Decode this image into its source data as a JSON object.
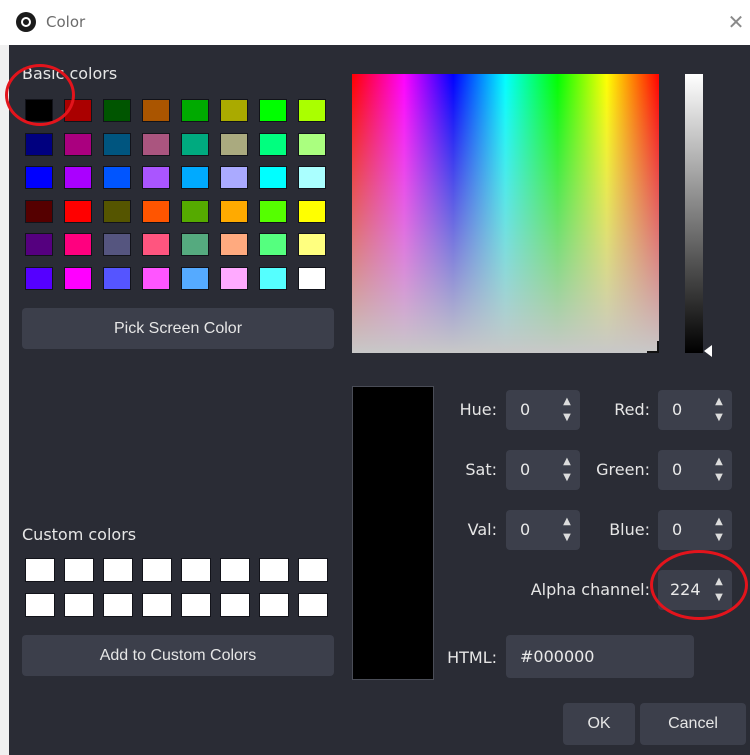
{
  "window": {
    "title": "Color",
    "close_glyph": "✕"
  },
  "basic_colors": {
    "label": "Basic colors",
    "swatches": [
      "#000000",
      "#aa0000",
      "#005500",
      "#aa5500",
      "#00aa00",
      "#aaaa00",
      "#00ff00",
      "#aaff00",
      "#00007f",
      "#aa007f",
      "#00557f",
      "#aa557f",
      "#00aa7f",
      "#aaaa7f",
      "#00ff7f",
      "#aaff7f",
      "#0000ff",
      "#aa00ff",
      "#0055ff",
      "#aa55ff",
      "#00aaff",
      "#aaaaff",
      "#00ffff",
      "#aaffff",
      "#550000",
      "#ff0000",
      "#555500",
      "#ff5500",
      "#55aa00",
      "#ffaa00",
      "#55ff00",
      "#ffff00",
      "#55007f",
      "#ff007f",
      "#55557f",
      "#ff557f",
      "#55aa7f",
      "#ffaa7f",
      "#55ff7f",
      "#ffff7f",
      "#5500ff",
      "#ff00ff",
      "#5555ff",
      "#ff55ff",
      "#55aaff",
      "#ffaaff",
      "#55ffff",
      "#ffffff"
    ]
  },
  "pick_screen_color_label": "Pick Screen Color",
  "custom_colors": {
    "label": "Custom colors",
    "swatches": [
      "#ffffff",
      "#ffffff",
      "#ffffff",
      "#ffffff",
      "#ffffff",
      "#ffffff",
      "#ffffff",
      "#ffffff",
      "#ffffff",
      "#ffffff",
      "#ffffff",
      "#ffffff",
      "#ffffff",
      "#ffffff",
      "#ffffff",
      "#ffffff"
    ]
  },
  "add_custom_label": "Add to Custom Colors",
  "preview_color": "#000000",
  "fields": {
    "hue": {
      "label": "Hue:",
      "value": "0"
    },
    "sat": {
      "label": "Sat:",
      "value": "0"
    },
    "val": {
      "label": "Val:",
      "value": "0"
    },
    "red": {
      "label": "Red:",
      "value": "0"
    },
    "green": {
      "label": "Green:",
      "value": "0"
    },
    "blue": {
      "label": "Blue:",
      "value": "0"
    },
    "alpha": {
      "label": "Alpha channel:",
      "value": "224"
    },
    "html": {
      "label": "HTML:",
      "value": "#000000"
    }
  },
  "ok_label": "OK",
  "cancel_label": "Cancel",
  "icons": {
    "up": "up-arrow-icon",
    "down": "down-arrow-icon"
  },
  "colors": {
    "dialog_bg": "#2a2c35",
    "control_bg": "#3c3f4b",
    "annotation": "#e3141c"
  }
}
